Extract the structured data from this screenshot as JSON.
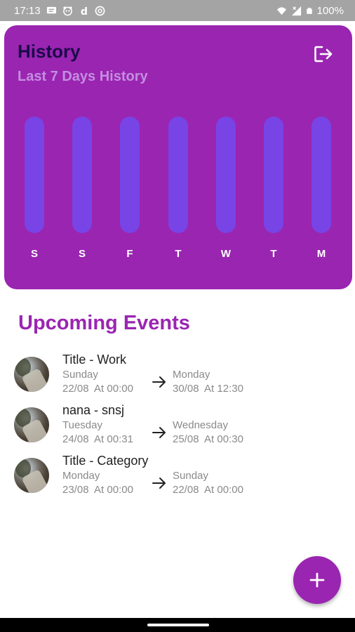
{
  "status_bar": {
    "time": "17:13",
    "battery": "100%",
    "left_icons": [
      "message-icon",
      "panda-icon",
      "d-icon",
      "at-icon"
    ],
    "right_icons": [
      "wifi-icon",
      "signal-icon",
      "battery-icon"
    ]
  },
  "history": {
    "title": "History",
    "subtitle": "Last 7 Days History",
    "logout_icon": "logout-icon",
    "days": [
      {
        "label": "S",
        "value": 0
      },
      {
        "label": "S",
        "value": 0
      },
      {
        "label": "F",
        "value": 0
      },
      {
        "label": "T",
        "value": 0
      },
      {
        "label": "W",
        "value": 0
      },
      {
        "label": "T",
        "value": 0
      },
      {
        "label": "M",
        "value": 0
      }
    ]
  },
  "upcoming": {
    "title": "Upcoming Events",
    "events": [
      {
        "title": "Title - Work",
        "start_day": "Sunday",
        "start_time": "22/08  At 00:00",
        "end_day": "Monday",
        "end_time": "30/08  At 12:30"
      },
      {
        "title": "nana - snsj",
        "start_day": "Tuesday",
        "start_time": "24/08  At 00:31",
        "end_day": "Wednesday",
        "end_time": "25/08  At 00:30"
      },
      {
        "title": "Title - Category",
        "start_day": "Monday",
        "start_time": "23/08  At 00:00",
        "end_day": "Sunday",
        "end_time": "22/08  At 00:00"
      }
    ]
  },
  "fab": {
    "icon": "plus-icon"
  },
  "colors": {
    "primary": "#9a25b1",
    "bar": "#7844e6",
    "title_dark": "#1c0a4a",
    "subtitle": "#c48ee0"
  }
}
